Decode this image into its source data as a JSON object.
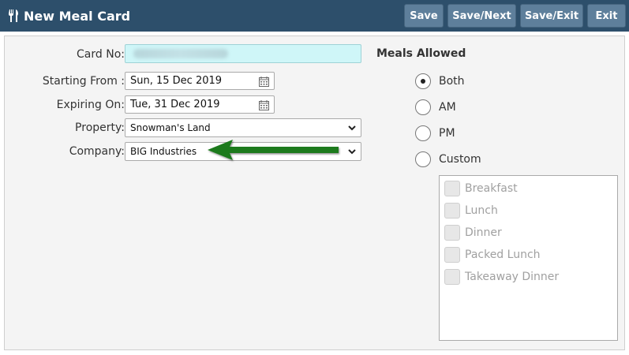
{
  "header": {
    "title": "New Meal Card",
    "buttons": {
      "save": "Save",
      "save_next": "Save/Next",
      "save_exit": "Save/Exit",
      "exit": "Exit"
    },
    "background_color": "#2d4f6b",
    "button_color": "#5e7f9b"
  },
  "form": {
    "card_no": {
      "label": "Card No:",
      "value": ""
    },
    "starting_from": {
      "label": "Starting From :",
      "value": "Sun, 15 Dec 2019"
    },
    "expiring_on": {
      "label": "Expiring On:",
      "value": "Tue, 31 Dec 2019"
    },
    "property": {
      "label": "Property:",
      "value": "Snowman's Land"
    },
    "company": {
      "label": "Company:",
      "value": "BIG Industries"
    }
  },
  "meals": {
    "title": "Meals Allowed",
    "options": [
      {
        "label": "Both",
        "checked": true
      },
      {
        "label": "AM",
        "checked": false
      },
      {
        "label": "PM",
        "checked": false
      },
      {
        "label": "Custom",
        "checked": false
      }
    ],
    "custom_items": [
      "Breakfast",
      "Lunch",
      "Dinner",
      "Packed Lunch",
      "Takeaway Dinner"
    ]
  },
  "annotation": {
    "arrow_color": "#1e7a1e"
  },
  "icons": [
    "meal-icon",
    "calendar-icon",
    "chevron-down-icon",
    "arrow-annotation"
  ]
}
